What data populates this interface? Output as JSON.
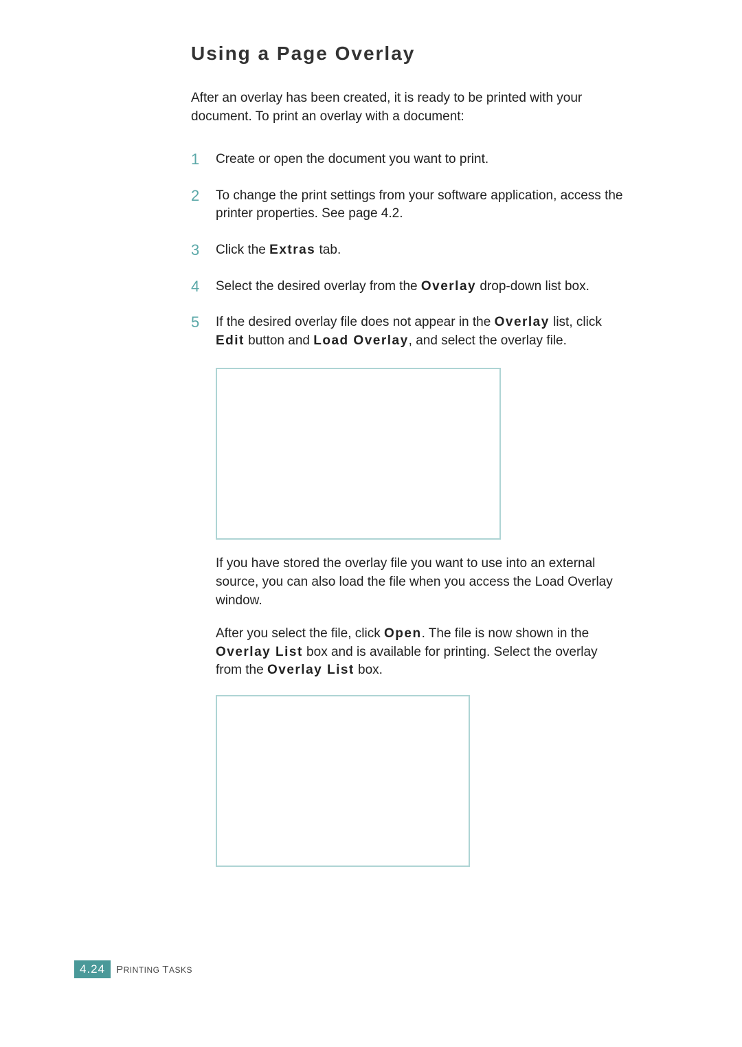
{
  "heading": "Using a Page Overlay",
  "intro": "After an overlay has been created, it is ready to be printed with your document. To print an overlay with a document:",
  "steps": {
    "s1": {
      "num": "1",
      "text": "Create or open the document you want to print."
    },
    "s2": {
      "num": "2",
      "text": "To change the print settings from your software application, access the printer properties. See page 4.2."
    },
    "s3": {
      "num": "3",
      "pre": "Click the ",
      "label1": "Extras",
      "post": " tab."
    },
    "s4": {
      "num": "4",
      "pre": "Select the desired overlay from the ",
      "label1": "Overlay",
      "post": " drop-down list box."
    },
    "s5": {
      "num": "5",
      "pre": "If the desired overlay file does not appear in the ",
      "label1": "Overlay",
      "mid1": " list, click ",
      "label2": "Edit",
      "mid2": " button and ",
      "label3": "Load Overlay",
      "post": ", and select the overlay file."
    }
  },
  "subpara1": "If you have stored the overlay file you want to use into an external source, you can also load the file when you access the Load Overlay window.",
  "subpara2": {
    "pre": "After you select the file, click ",
    "label1": "Open",
    "mid1": ". The file is now shown in the ",
    "label2": "Overlay List",
    "mid2": " box and is available for printing. Select the overlay from the ",
    "label3": "Overlay List",
    "post": " box."
  },
  "footer": {
    "page": "4.24",
    "section_caps": "P",
    "section_rest": "RINTING ",
    "section_caps2": "T",
    "section_rest2": "ASKS"
  }
}
